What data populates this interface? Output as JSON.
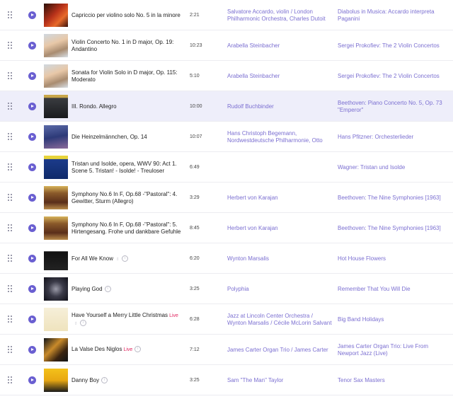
{
  "colors": {
    "accent": "#6a5fd1",
    "link": "#7b6fd1",
    "live": "#e0245e",
    "active_row": "#eeeefa"
  },
  "tracks": [
    {
      "title": "Capriccio per violino solo No. 5 in la minore",
      "duration": "2:21",
      "artist": "Salvatore Accardo, violin / London Philharmonic Orchestra, Charles Dutoit",
      "album": "Diabolus in Musica: Accardo interpreta Paganini",
      "cover": "red-orange",
      "active": false
    },
    {
      "title": "Violin Concerto No. 1 in D major, Op. 19: Andantino",
      "duration": "10:23",
      "artist": "Arabella Steinbacher",
      "album": "Sergei Prokofiev: The 2 Violin Concertos",
      "cover": "portrait-light",
      "active": false
    },
    {
      "title": "Sonata for Violin Solo in D major, Op. 115: Moderato",
      "duration": "5:10",
      "artist": "Arabella Steinbacher",
      "album": "Sergei Prokofiev: The 2 Violin Concertos",
      "cover": "portrait-light",
      "active": false
    },
    {
      "title": "III. Rondo. Allegro",
      "duration": "10:00",
      "artist": "Rudolf Buchbinder",
      "album": "Beethoven: Piano Concerto No. 5, Op. 73 \"Emperor\"",
      "cover": "dark-grey",
      "active": true
    },
    {
      "title": "Die Heinzelmännchen, Op. 14",
      "duration": "10:07",
      "artist": "Hans Christoph Begemann, Nordwestdeutsche Philharmonie, Otto",
      "album": "Hans Pfitzner: Orchesterlieder",
      "cover": "blue-purple",
      "active": false
    },
    {
      "title": "Tristan und Isolde, opera, WWV 90: Act 1. Scene 5. Tristan! - Isolde! - Treuloser",
      "duration": "6:49",
      "artist": "",
      "album": "Wagner: Tristan und Isolde",
      "cover": "blue-label",
      "active": false
    },
    {
      "title": "Symphony No.6 In F, Op.68 -\"Pastoral\": 4. Gewitter, Sturm (Allegro)",
      "duration": "3:29",
      "artist": "Herbert von Karajan",
      "album": "Beethoven: The Nine Symphonies [1963]",
      "cover": "brown-gold",
      "active": false
    },
    {
      "title": "Symphony No.6 In F, Op.68 -\"Pastoral\": 5. Hirtengesang. Frohe und dankbare Gefuhle",
      "duration": "8:45",
      "artist": "Herbert von Karajan",
      "album": "Beethoven: The Nine Symphonies [1963]",
      "cover": "brown-gold",
      "active": false
    },
    {
      "title": "For All We Know",
      "duration": "6:20",
      "artist": "Wynton Marsalis",
      "album": "Hot House Flowers",
      "cover": "black-white",
      "active": false,
      "badges": [
        "e",
        "i"
      ]
    },
    {
      "title": "Playing God",
      "duration": "3:25",
      "artist": "Polyphia",
      "album": "Remember That You Will Die",
      "cover": "dark-ornate",
      "active": false,
      "badges": [
        "i"
      ]
    },
    {
      "title": "Have Yourself a Merry Little Christmas",
      "duration": "6:28",
      "live": "Live",
      "artist": "Jazz at Lincoln Center Orchestra / Wynton Marsalis / Cécile McLorin Salvant",
      "album": "Big Band Holidays",
      "cover": "cream-script",
      "active": false,
      "badges": [
        "e",
        "i"
      ]
    },
    {
      "title": "La Valse Des Niglos",
      "duration": "7:12",
      "live": "Live",
      "artist": "James Carter Organ Trio / James Carter",
      "album": "James Carter Organ Trio: Live From Newport Jazz (Live)",
      "cover": "gold-dark",
      "active": false,
      "badges": [
        "i"
      ]
    },
    {
      "title": "Danny Boy",
      "duration": "3:25",
      "artist": "Sam \"The Man\" Taylor",
      "album": "Tenor Sax Masters",
      "cover": "yellow-black",
      "active": false,
      "badges": [
        "i"
      ]
    }
  ]
}
